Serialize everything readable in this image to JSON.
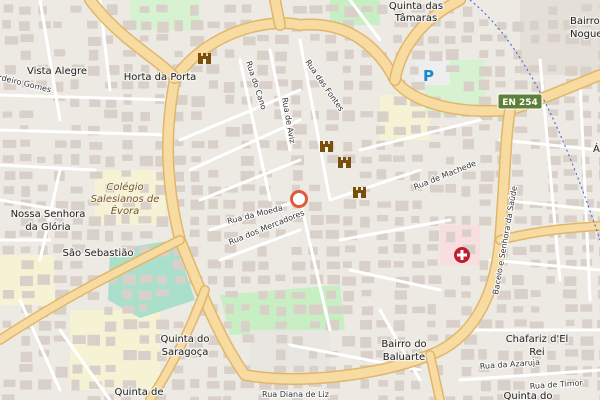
{
  "map": {
    "colors": {
      "background": "#ede9e3",
      "building": "#d9d0c9",
      "road": "#ffffff",
      "primary_road": "#f7dba0",
      "primary_casing": "#e0b76a",
      "park": "#c8efc3",
      "garden": "#d7f2d0",
      "pitch": "#aae0cb",
      "parking": "#eeeeee",
      "school": "#f6f3d5",
      "hospital": "#f8dede",
      "poi_brown": "#7a4f0b",
      "marker": "#e05a3a",
      "shield": "#5d7f3a",
      "parking_icon": "#1a87d0"
    },
    "places": {
      "quinta_das_tamaras": [
        "Quinta das",
        "Tâmaras"
      ],
      "bairro_nogueiras": [
        "Bairro",
        "Nogue"
      ],
      "vista_alegre": "Vista Alegre",
      "horta_da_porta": "Horta da Porta",
      "cordeiro_gomes": "rdeiro Gomes",
      "nossa_senhora": [
        "Nossa Senhora",
        "da Glória"
      ],
      "sao_sebastiao": "São Sebastião",
      "quinta_saragoca": [
        "Quinta do",
        "Saragoça"
      ],
      "bairro_baluarte": [
        "Bairro do",
        "Baluarte"
      ],
      "chafariz": [
        "Chafariz d'El",
        "Rei"
      ],
      "quinta_de": "Quinta de",
      "quinta_do_bottom": "Quinta do",
      "right_edge": "Á"
    },
    "streets": {
      "rua_do_cano": "Rua do Cano",
      "rua_aviz": "Rua de Aviz",
      "rua_tendas": "Rua das Fontes",
      "rua_machede": "Rua de Machede",
      "rua_da_moeda": "Rua da Moeda",
      "rua_dos_mercadores": "Rua dos Mercadores",
      "baceio_senhora_saude": "Baceio e Senhora da Saúde",
      "rua_da_azaruja": "Rua da Azaruja",
      "rua_de_timor": "Rua de Timor",
      "rua_diana_de_liz": "Rua Diana de Liz"
    },
    "pois": {
      "colegio": [
        "Colégio",
        "Salesianos de",
        "Évora"
      ]
    },
    "road_shield": "EN 254",
    "icons": {
      "castle": "castle-icon",
      "parking": "parking-icon",
      "hospital": "hospital-icon",
      "marker": "location-marker-icon"
    }
  }
}
